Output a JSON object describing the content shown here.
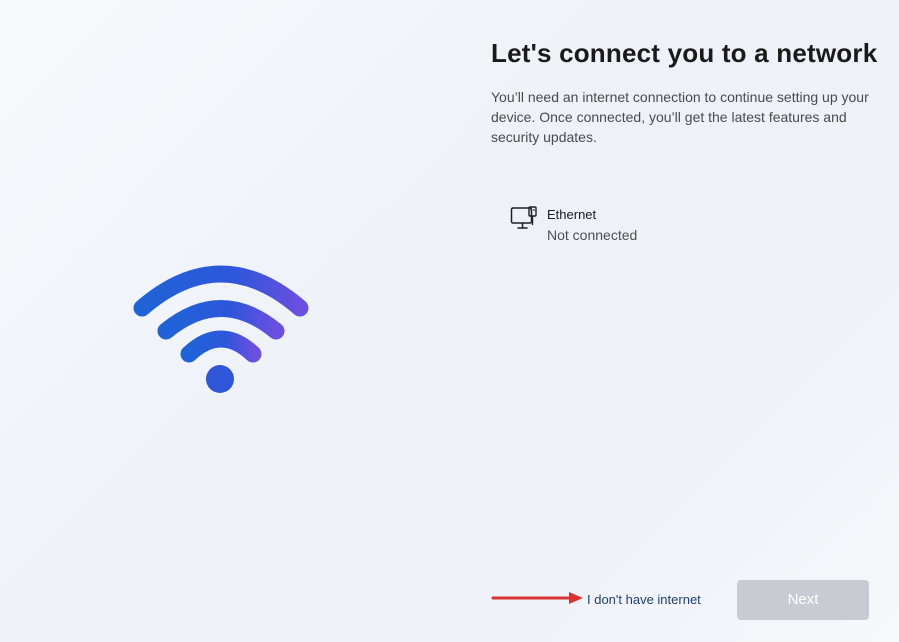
{
  "page": {
    "title": "Let's connect you to a network",
    "description": "You’ll need an internet connection to continue setting up your device. Once connected, you’ll get the latest features and security updates."
  },
  "illustration": {
    "icon": "wifi-icon",
    "colors": {
      "start": "#1f63d8",
      "mid": "#2d56da",
      "end": "#6a4fe0"
    }
  },
  "networks": [
    {
      "icon": "ethernet-monitor-icon",
      "name": "Ethernet",
      "status": "Not connected"
    }
  ],
  "footer": {
    "no_internet_label": "I don't have internet",
    "next_label": "Next",
    "next_enabled": false
  },
  "annotation": {
    "type": "arrow",
    "color": "#d93232"
  }
}
